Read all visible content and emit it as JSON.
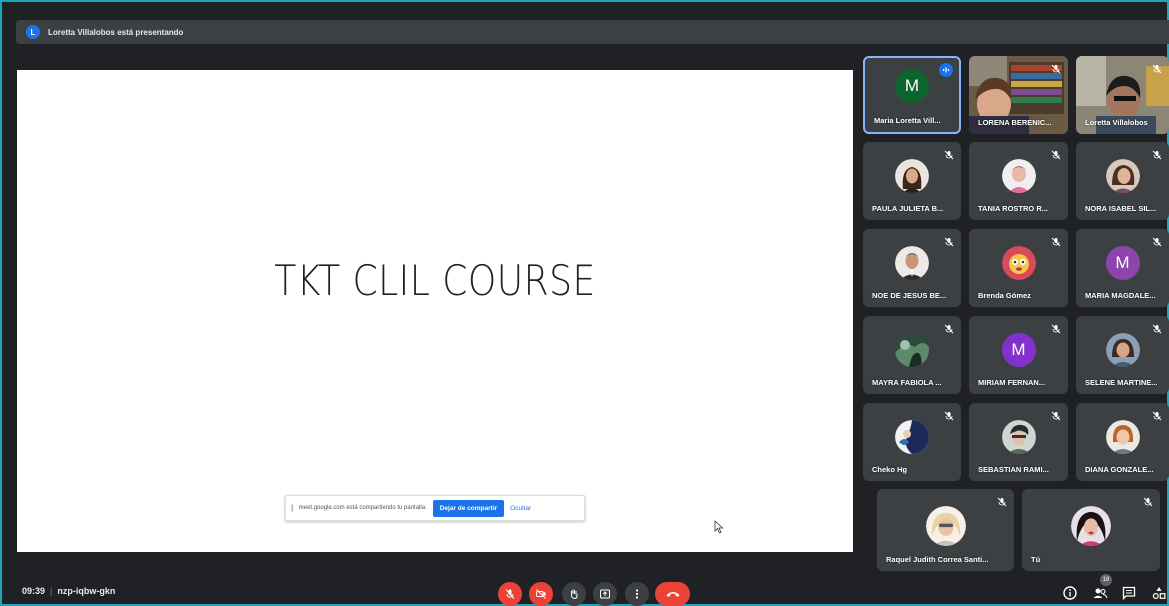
{
  "presenting": {
    "avatar_letter": "L",
    "text": "Loretta Villalobos está presentando"
  },
  "slide": {
    "title": "TKT  CLIL COURSE"
  },
  "share_banner": {
    "handle": "||",
    "message": "meet.google.com está compartiendo tu pantalla.",
    "stop_label": "Dejar de compartir",
    "hide_label": "Ocultar"
  },
  "participants": [
    {
      "name": "Maria Loretta Vill...",
      "avatar": "M",
      "color": "#0d652d"
    },
    {
      "name": "LORENA BERENIC...",
      "avatar": "video-camera-feed"
    },
    {
      "name": "Loretta Villalobos",
      "avatar": "video-camera-feed"
    },
    {
      "name": "PAULA JULIETA B...",
      "avatar": "profile-photo"
    },
    {
      "name": "TANIA ROSTRO R...",
      "avatar": "profile-photo"
    },
    {
      "name": "NORA ISABEL SIL...",
      "avatar": "profile-photo"
    },
    {
      "name": "NOE DE JESUS BE...",
      "avatar": "profile-photo"
    },
    {
      "name": "Brenda Gómez",
      "avatar": "profile-photo"
    },
    {
      "name": "MARIA MAGDALE...",
      "avatar": "M",
      "color": "#8e44ad"
    },
    {
      "name": "MAYRA FABIOLA ...",
      "avatar": "profile-photo"
    },
    {
      "name": "MIRIAM FERNAN...",
      "avatar": "M",
      "color": "#8430ce"
    },
    {
      "name": "SELENE MARTINE...",
      "avatar": "profile-photo"
    },
    {
      "name": "Cheko Hg",
      "avatar": "profile-photo"
    },
    {
      "name": "SEBASTIAN RAMI...",
      "avatar": "profile-photo"
    },
    {
      "name": "DIANA GONZALE...",
      "avatar": "profile-photo"
    },
    {
      "name": "Raquel Judith Correa Santi...",
      "avatar": "profile-photo"
    },
    {
      "name": "Tú",
      "avatar": "profile-photo"
    }
  ],
  "bottom_bar": {
    "time": "09:39",
    "meeting_code": "nzp-iqbw-gkn",
    "people_count": "18"
  },
  "colors": {
    "accent": "#1a73e8",
    "danger": "#ea4335",
    "surface": "#3c4043",
    "background": "#202124"
  }
}
